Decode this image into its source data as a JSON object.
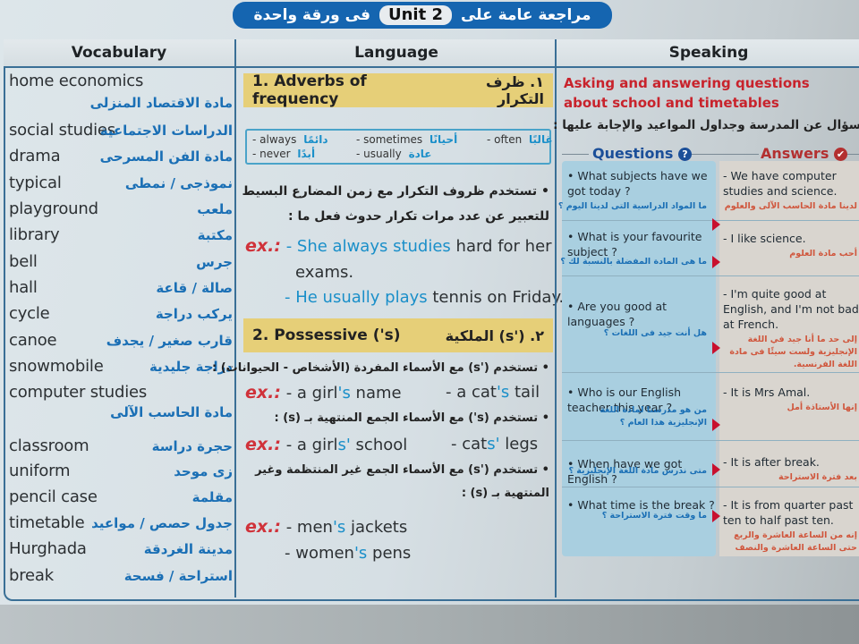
{
  "banner": {
    "prefix_ar": "مراجعة عامة على",
    "unit": "Unit 2",
    "suffix_ar": "فى ورقة واحدة"
  },
  "columns": {
    "vocabulary": "Vocabulary",
    "language": "Language",
    "speaking": "Speaking"
  },
  "vocabulary": [
    {
      "en": "home economics",
      "ar": "مادة الاقتصاد المنزلى"
    },
    {
      "en": "social studies",
      "ar": "الدراسات الاجتماعية"
    },
    {
      "en": "drama",
      "ar": "مادة الفن المسرحى"
    },
    {
      "en": "typical",
      "ar": "نموذجى / نمطى"
    },
    {
      "en": "playground",
      "ar": "ملعب"
    },
    {
      "en": "library",
      "ar": "مكتبة"
    },
    {
      "en": "bell",
      "ar": "جرس"
    },
    {
      "en": "hall",
      "ar": "صالة / قاعة"
    },
    {
      "en": "cycle",
      "ar": "يركب دراجة"
    },
    {
      "en": "canoe",
      "ar": "قارب صغير / يجدف"
    },
    {
      "en": "snowmobile",
      "ar": "دراجة جليدية"
    },
    {
      "en": "computer studies",
      "ar": "مادة الحاسب الآلى"
    },
    {
      "en": "classroom",
      "ar": "حجرة دراسة"
    },
    {
      "en": "uniform",
      "ar": "زى موحد"
    },
    {
      "en": "pencil case",
      "ar": "مقلمة"
    },
    {
      "en": "timetable",
      "ar": "جدول حصص / مواعيد"
    },
    {
      "en": "Hurghada",
      "ar": "مدينة الغردقة"
    },
    {
      "en": "break",
      "ar": "استراحة / فسحة"
    }
  ],
  "language": {
    "section1": {
      "title_en": "1. Adverbs of frequency",
      "title_ar": "١. ظرف التكرار",
      "adverbs": [
        {
          "en": "- always",
          "ar": "دائمًا"
        },
        {
          "en": "- sometimes",
          "ar": "أحيانًا"
        },
        {
          "en": "- often",
          "ar": "غالبًا"
        },
        {
          "en": "- never",
          "ar": "أبدًا"
        },
        {
          "en": "- usually",
          "ar": "عادة"
        }
      ],
      "rule_ar_1": "• تستخدم ظروف التكرار مع زمن المضارع البسيط",
      "rule_ar_2": "للتعبير عن عدد مرات تكرار حدوث فعل ما :",
      "ex_label": "ex.:",
      "ex1_highlight": "- She always studies",
      "ex1_rest": " hard for her",
      "ex1_cont": "exams.",
      "ex2_highlight": "- He usually plays",
      "ex2_rest": " tennis on Friday."
    },
    "section2": {
      "title_en": "2. Possessive ('s)",
      "title_ar": "٢. ('s) الملكية",
      "rule1_ar": "• تستخدم ('s) مع الأسماء المفردة (الأشخاص - الحيوانات) :",
      "ex1a": [
        "- a girl",
        "'s",
        " name"
      ],
      "ex1b": [
        "- a cat",
        "'s",
        " tail"
      ],
      "rule2_ar": "• تستخدم (s') مع الأسماء الجمع المنتهية بـ (s) :",
      "ex2a": [
        "- a girl",
        "s'",
        " school"
      ],
      "ex2b": [
        "- cat",
        "s'",
        " legs"
      ],
      "rule3_ar_1": "• تستخدم ('s) مع الأسماء الجمع غير المنتظمة وغير",
      "rule3_ar_2": "المنتهية بـ (s) :",
      "ex3a": [
        "- men",
        "'s",
        " jackets"
      ],
      "ex3b": [
        "- women",
        "'s",
        " pens"
      ],
      "ex_label": "ex.:"
    }
  },
  "speaking": {
    "title": "Asking and answering questions about school and timetables",
    "subtitle_ar": "سؤال عن المدرسة وجداول المواعيد والإجابة عليها :",
    "questions_label": "Questions",
    "answers_label": "Answers",
    "questions_icon": "?",
    "answers_icon": "✔",
    "pairs": [
      {
        "q": "• What subjects have we got today ?",
        "q_ar": "ما المواد الدراسية التى لدينا اليوم ؟",
        "a": "- We have computer studies and science.",
        "a_ar": "لدينا مادة الحاسب الآلى والعلوم"
      },
      {
        "q": "• What is your favourite subject ?",
        "q_ar": "ما هى المادة المفضلة بالنسبة لك ؟",
        "a": "- I like science.",
        "a_ar": "أحب مادة العلوم"
      },
      {
        "q": "• Are you good at languages ?",
        "q_ar": "هل أنت جيد فى اللغات ؟",
        "a": "- I'm quite good at English, and I'm not bad at French.",
        "a_ar": "إلى حد ما أنا جيد في اللغة الإنجليزية ولست سيئًا فى مادة اللغة الفرنسية."
      },
      {
        "q": "• Who is our English teacher this year ?",
        "q_ar": "من هو مدرسنا لمادة اللغة الإنجليزية هذا العام ؟",
        "a": "- It is Mrs Amal.",
        "a_ar": "إنها الأستاذة أمل"
      },
      {
        "q": "• When have we got English ?",
        "q_ar": "متى ندرس مادة اللغة الإنجليزية ؟",
        "a": "- It is after break.",
        "a_ar": "بعد فترة الاستراحة"
      },
      {
        "q": "• What time is the break ?",
        "q_ar": "ما وقت فترة الاستراحة ؟",
        "a": "- It is from quarter past ten to half past ten.",
        "a_ar": "إنه من الساعة العاشرة والربع حتى الساعة العاشرة والنصف"
      }
    ]
  }
}
